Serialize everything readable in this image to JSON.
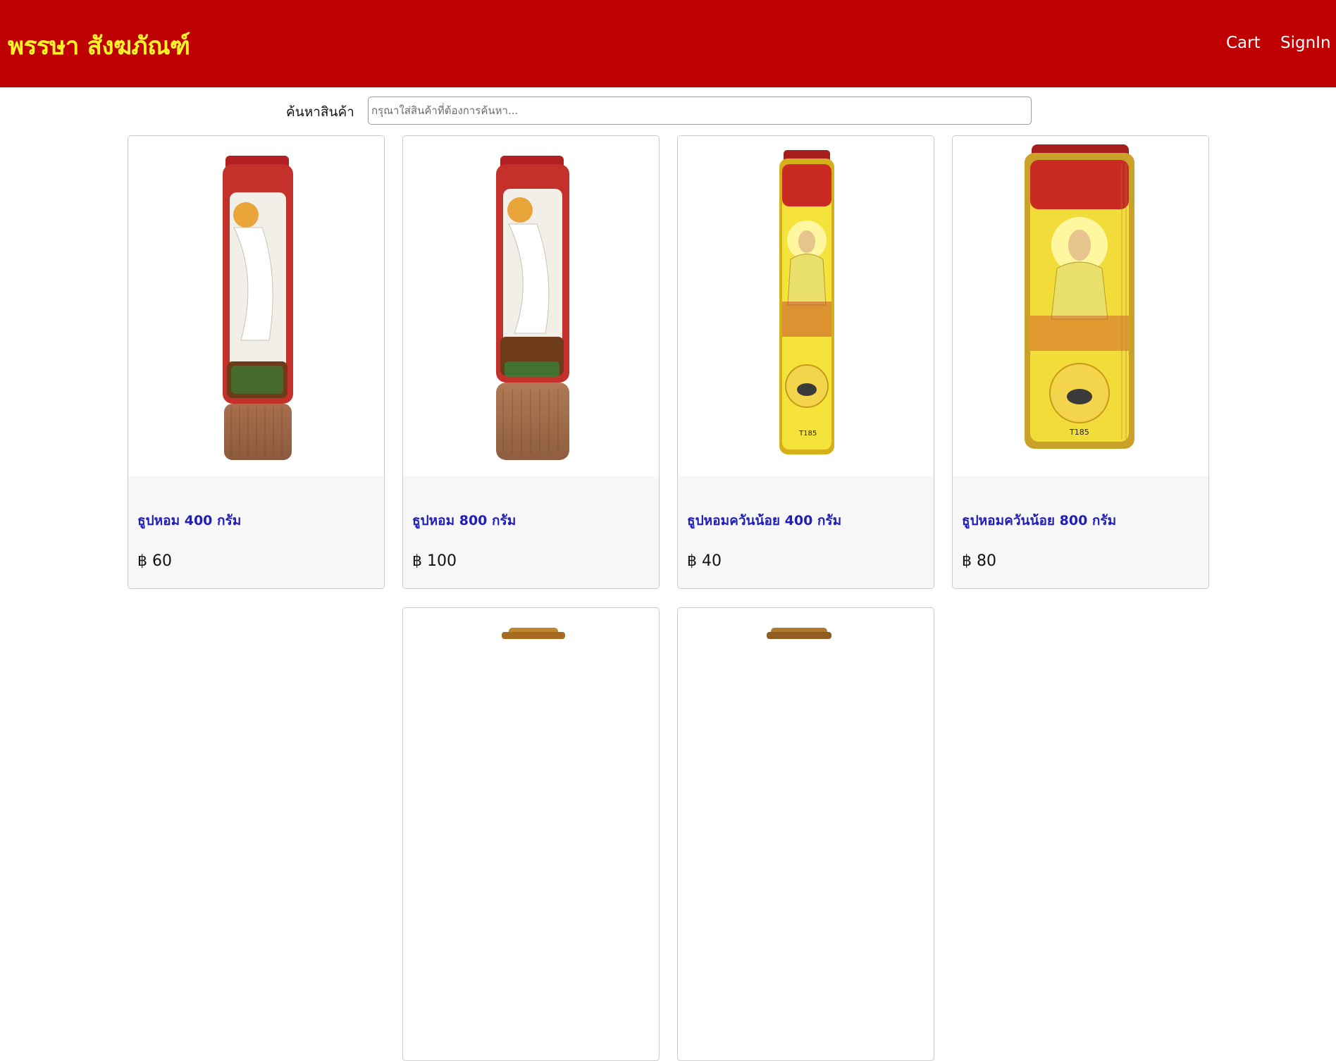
{
  "header": {
    "brand": "พรรษา สังฆภัณฑ์",
    "nav": {
      "cart_label": "Cart",
      "signin_label": "SignIn"
    }
  },
  "search": {
    "label": "ค้นหาสินค้า",
    "placeholder": "กรุณาใส่สินค้าที่ต้องการค้นหา..."
  },
  "products": [
    {
      "title": "ธูปหอม 400 กรัม",
      "price": "฿ 60"
    },
    {
      "title": "ธูปหอม 800 กรัม",
      "price": "฿ 100"
    },
    {
      "title": "ธูปหอมควันน้อย 400 กรัม",
      "price": "฿ 40"
    },
    {
      "title": "ธูปหอมควันน้อย 800 กรัม",
      "price": "฿ 80"
    }
  ],
  "colors": {
    "header_bg": "#bf0000",
    "brand_text": "#fff22a",
    "product_title": "#1f1fb8",
    "card_body_bg": "#f7f7f7"
  }
}
